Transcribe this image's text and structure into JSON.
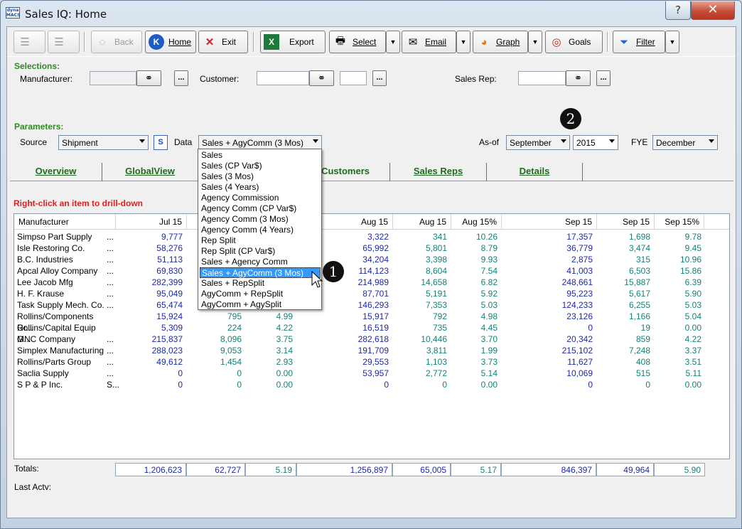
{
  "window": {
    "title": "Sales IQ: Home",
    "app_icon_text": "dyna MACS",
    "help_label": "?",
    "close_label": "✕"
  },
  "toolbar": {
    "back_label": "Back",
    "home_label": "Home",
    "exit_label": "Exit",
    "export_label": "Export",
    "select_label": "Select",
    "email_label": "Email",
    "graph_label": "Graph",
    "goals_label": "Goals",
    "filter_label": "Filter"
  },
  "selections": {
    "heading": "Selections:",
    "manufacturer_label": "Manufacturer:",
    "customer_label": "Customer:",
    "salesrep_label": "Sales Rep:",
    "dots": "..."
  },
  "parameters": {
    "heading": "Parameters:",
    "source_label": "Source",
    "source_value": "Shipment",
    "s_button": "S",
    "data_label": "Data",
    "data_value": "Sales + AgyComm (3 Mos)",
    "asof_label": "As-of",
    "asof_month": "September",
    "asof_year": "2015",
    "fye_label": "FYE",
    "fye_value": "December"
  },
  "tabs": [
    {
      "label": "Overview"
    },
    {
      "label": "GlobalView"
    },
    {
      "label": "Customers"
    },
    {
      "label": "Sales Reps"
    },
    {
      "label": "Details"
    }
  ],
  "drill_hint": "Right-click an item to drill-down",
  "grid": {
    "headers": [
      "Manufacturer",
      "Jul 15",
      "Aug 15",
      "Aug 15",
      "Aug 15%",
      "Sep 15",
      "Sep 15",
      "Sep 15%"
    ],
    "rows": [
      {
        "name": "Simpso Part Supply",
        "suffix": "...",
        "jul": "9,777",
        "jul2": "",
        "jul3": "",
        "aug": "3,322",
        "aug2": "341",
        "aug3": "10.26",
        "sep": "17,357",
        "sep2": "1,698",
        "sep3": "9.78"
      },
      {
        "name": "Isle Restoring Co.",
        "suffix": "...",
        "jul": "58,276",
        "jul2": "",
        "jul3": "",
        "aug": "65,992",
        "aug2": "5,801",
        "aug3": "8.79",
        "sep": "36,779",
        "sep2": "3,474",
        "sep3": "9.45"
      },
      {
        "name": "B.C. Industries",
        "suffix": "...",
        "jul": "51,113",
        "jul2": "",
        "jul3": "",
        "aug": "34,204",
        "aug2": "3,398",
        "aug3": "9.93",
        "sep": "2,875",
        "sep2": "315",
        "sep3": "10.96"
      },
      {
        "name": "Apcal Alloy Company",
        "suffix": "...",
        "jul": "69,830",
        "jul2": "",
        "jul3": "",
        "aug": "114,123",
        "aug2": "8,604",
        "aug3": "7.54",
        "sep": "41,003",
        "sep2": "6,503",
        "sep3": "15.86"
      },
      {
        "name": "Lee Jacob Mfg",
        "suffix": "...",
        "jul": "282,399",
        "jul2": "",
        "jul3": "",
        "aug": "214,989",
        "aug2": "14,658",
        "aug3": "6.82",
        "sep": "248,661",
        "sep2": "15,887",
        "sep3": "6.39"
      },
      {
        "name": "H. F. Krause",
        "suffix": "...",
        "jul": "95,049",
        "jul2": "",
        "jul3": "",
        "aug": "87,701",
        "aug2": "5,191",
        "aug3": "5.92",
        "sep": "95,223",
        "sep2": "5,617",
        "sep3": "5.90"
      },
      {
        "name": "Task Supply Mech. Co.",
        "suffix": "...",
        "jul": "65,474",
        "jul2": "",
        "jul3": "",
        "aug": "146,293",
        "aug2": "7,353",
        "aug3": "5.03",
        "sep": "124,233",
        "sep2": "6,255",
        "sep3": "5.03"
      },
      {
        "name": "Rollins/Components Gr...",
        "suffix": "",
        "jul": "15,924",
        "jul2": "795",
        "jul3": "4.99",
        "aug": "15,917",
        "aug2": "792",
        "aug3": "4.98",
        "sep": "23,126",
        "sep2": "1,166",
        "sep3": "5.04"
      },
      {
        "name": "Rollins/Capital Equip G...",
        "suffix": "",
        "jul": "5,309",
        "jul2": "224",
        "jul3": "4.22",
        "aug": "16,519",
        "aug2": "735",
        "aug3": "4.45",
        "sep": "0",
        "sep2": "19",
        "sep3": "0.00"
      },
      {
        "name": "MNC Company",
        "suffix": "...",
        "jul": "215,837",
        "jul2": "8,096",
        "jul3": "3.75",
        "aug": "282,618",
        "aug2": "10,446",
        "aug3": "3.70",
        "sep": "20,342",
        "sep2": "859",
        "sep3": "4.22"
      },
      {
        "name": "Simplex Manufacturing",
        "suffix": "...",
        "jul": "288,023",
        "jul2": "9,053",
        "jul3": "3.14",
        "aug": "191,709",
        "aug2": "3,811",
        "aug3": "1.99",
        "sep": "215,102",
        "sep2": "7,248",
        "sep3": "3.37"
      },
      {
        "name": "Rollins/Parts Group",
        "suffix": "...",
        "jul": "49,612",
        "jul2": "1,454",
        "jul3": "2.93",
        "aug": "29,553",
        "aug2": "1,103",
        "aug3": "3.73",
        "sep": "11,627",
        "sep2": "408",
        "sep3": "3.51"
      },
      {
        "name": "Saclia Supply",
        "suffix": "...",
        "jul": "0",
        "jul2": "0",
        "jul3": "0.00",
        "aug": "53,957",
        "aug2": "2,772",
        "aug3": "5.14",
        "sep": "10,069",
        "sep2": "515",
        "sep3": "5.11"
      },
      {
        "name": "S P & P Inc.",
        "suffix": "S...",
        "jul": "0",
        "jul2": "0",
        "jul3": "0.00",
        "aug": "0",
        "aug2": "0",
        "aug3": "0.00",
        "sep": "0",
        "sep2": "0",
        "sep3": "0.00"
      }
    ]
  },
  "totals": {
    "label": "Totals:",
    "values": [
      "1,206,623",
      "62,727",
      "5.19",
      "1,256,897",
      "65,005",
      "5.17",
      "846,397",
      "49,964",
      "5.90"
    ]
  },
  "last_activity_label": "Last Actv:",
  "data_dropdown": {
    "options": [
      "Sales",
      "Sales (CP Var$)",
      "Sales (3 Mos)",
      "Sales (4 Years)",
      "Agency Commission",
      "Agency Comm (CP Var$)",
      "Agency Comm (3 Mos)",
      "Agency Comm (4 Years)",
      "Rep Split",
      "Rep Split  (CP Var$)",
      "Sales + Agency Comm",
      "Sales + AgyComm (3 Mos)",
      "Sales + RepSplit",
      "AgyComm + RepSplit",
      "AgyComm + AgySplit"
    ],
    "selected_index": 11
  },
  "callouts": {
    "one": "1",
    "two": "2"
  },
  "colors": {
    "accent_green": "#2e8b22",
    "warning_red": "#e02020",
    "number_blue": "#1c2aa8",
    "number_teal": "#16807a",
    "highlight": "#3399ff"
  }
}
